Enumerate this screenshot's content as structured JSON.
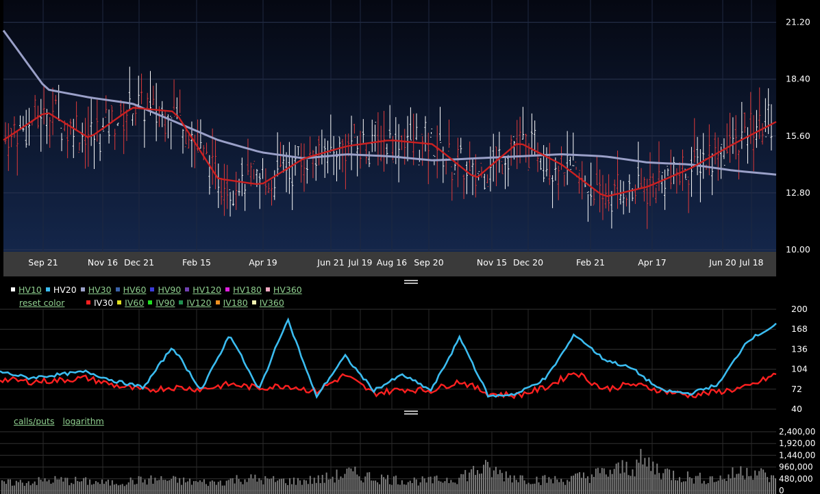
{
  "price_chart": {
    "y_ticks": [
      "21.20",
      "18.40",
      "15.60",
      "12.80",
      "10.00"
    ],
    "x_ticks": [
      "Sep 21",
      "Nov 16",
      "Dec 21",
      "Feb 15",
      "Apr 19",
      "Jun 21",
      "Jul 19",
      "Aug 16",
      "Sep 20",
      "Nov 15",
      "Dec 20",
      "Feb 21",
      "Apr 17",
      "Jun 20",
      "Jul 18"
    ]
  },
  "legend": {
    "hv_items": [
      {
        "label": "HV10",
        "color": "#ffffff",
        "active": false
      },
      {
        "label": "HV20",
        "color": "#3bbcf0",
        "active": true
      },
      {
        "label": "HV30",
        "color": "#9aa0c8",
        "active": false
      },
      {
        "label": "HV60",
        "color": "#3a62a8",
        "active": false
      },
      {
        "label": "HV90",
        "color": "#3a3ad8",
        "active": false
      },
      {
        "label": "HV120",
        "color": "#7040b0",
        "active": false
      },
      {
        "label": "HV180",
        "color": "#e020e0",
        "active": false
      },
      {
        "label": "HV360",
        "color": "#f0a8c0",
        "active": false
      }
    ],
    "reset_label": "reset color",
    "iv_items": [
      {
        "label": "IV30",
        "color": "#ff2020",
        "active": true
      },
      {
        "label": "IV60",
        "color": "#e0e020",
        "active": false
      },
      {
        "label": "IV90",
        "color": "#20e020",
        "active": false
      },
      {
        "label": "IV120",
        "color": "#209050",
        "active": false
      },
      {
        "label": "IV180",
        "color": "#f09020",
        "active": false
      },
      {
        "label": "IV360",
        "color": "#f0f0b0",
        "active": false
      }
    ]
  },
  "vol_chart": {
    "y_ticks": [
      "200",
      "168",
      "136",
      "104",
      "72",
      "40"
    ]
  },
  "volume_chart": {
    "y_ticks": [
      "2,400,00",
      "1,920,00",
      "1,440,00",
      "960,000",
      "480,000",
      "0"
    ],
    "toolbar": {
      "calls_puts": "calls/puts",
      "logarithm": "logarithm"
    }
  },
  "colors": {
    "up_candle": "#ffffff",
    "down_candle": "#e03a3a",
    "ma_long": "#9aa0c8",
    "ma_short": "#cc2020",
    "hv20": "#3bbcf0",
    "iv30": "#ff2020"
  },
  "chart_data": [
    {
      "type": "line",
      "title": "",
      "x": [
        "Sep 21",
        "Nov 16",
        "Dec 21",
        "Feb 15",
        "Apr 19",
        "Jun 21",
        "Jul 19",
        "Aug 16",
        "Sep 20",
        "Nov 15",
        "Dec 20",
        "Feb 21",
        "Apr 17",
        "Jun 20",
        "Jul 18"
      ],
      "ylim": [
        10.0,
        22.4
      ],
      "series": [
        {
          "values": [
            15.4,
            16.8,
            15.5,
            17.0,
            16.8,
            13.5,
            13.2,
            14.5,
            15.1,
            15.4,
            15.2,
            13.5,
            15.3,
            14.2,
            12.6,
            13.1,
            14.0,
            15.2,
            16.3
          ]
        },
        {
          "values": [
            20.8,
            17.9,
            17.5,
            17.2,
            16.3,
            15.4,
            14.8,
            14.5,
            14.7,
            14.6,
            14.4,
            14.5,
            14.6,
            14.7,
            14.6,
            14.3,
            14.2,
            13.9,
            13.7
          ]
        }
      ]
    },
    {
      "type": "line",
      "title": "",
      "x": [
        "Sep 21",
        "Nov 16",
        "Dec 21",
        "Feb 15",
        "Apr 19",
        "Jun 21",
        "Jul 19",
        "Aug 16",
        "Sep 20",
        "Nov 15",
        "Dec 20",
        "Feb 21",
        "Apr 17",
        "Jun 20",
        "Jul 18"
      ],
      "ylim": [
        40,
        200
      ],
      "series": [
        {
          "name": "HV20",
          "values": [
            100,
            90,
            95,
            100,
            85,
            75,
            140,
            70,
            160,
            70,
            185,
            60,
            125,
            70,
            95,
            70,
            155,
            60,
            65,
            90,
            160,
            120,
            105,
            70,
            65,
            80,
            150,
            175
          ]
        },
        {
          "name": "IV30",
          "values": [
            88,
            84,
            86,
            90,
            78,
            70,
            75,
            72,
            80,
            74,
            78,
            68,
            95,
            65,
            72,
            70,
            85,
            65,
            62,
            75,
            100,
            72,
            80,
            70,
            62,
            68,
            75,
            96
          ]
        }
      ]
    },
    {
      "type": "bar",
      "title": "",
      "ylim": [
        0,
        2400000
      ],
      "values": [
        300000,
        350000,
        420000,
        380000,
        300000,
        400000,
        450000,
        360000,
        320000,
        500000,
        420000,
        380000,
        460000,
        700000,
        520000,
        420000,
        380000,
        500000,
        900000,
        600000,
        450000,
        420000,
        600000,
        800000,
        1150000,
        700000,
        500000,
        480000,
        900000,
        420000
      ]
    }
  ]
}
